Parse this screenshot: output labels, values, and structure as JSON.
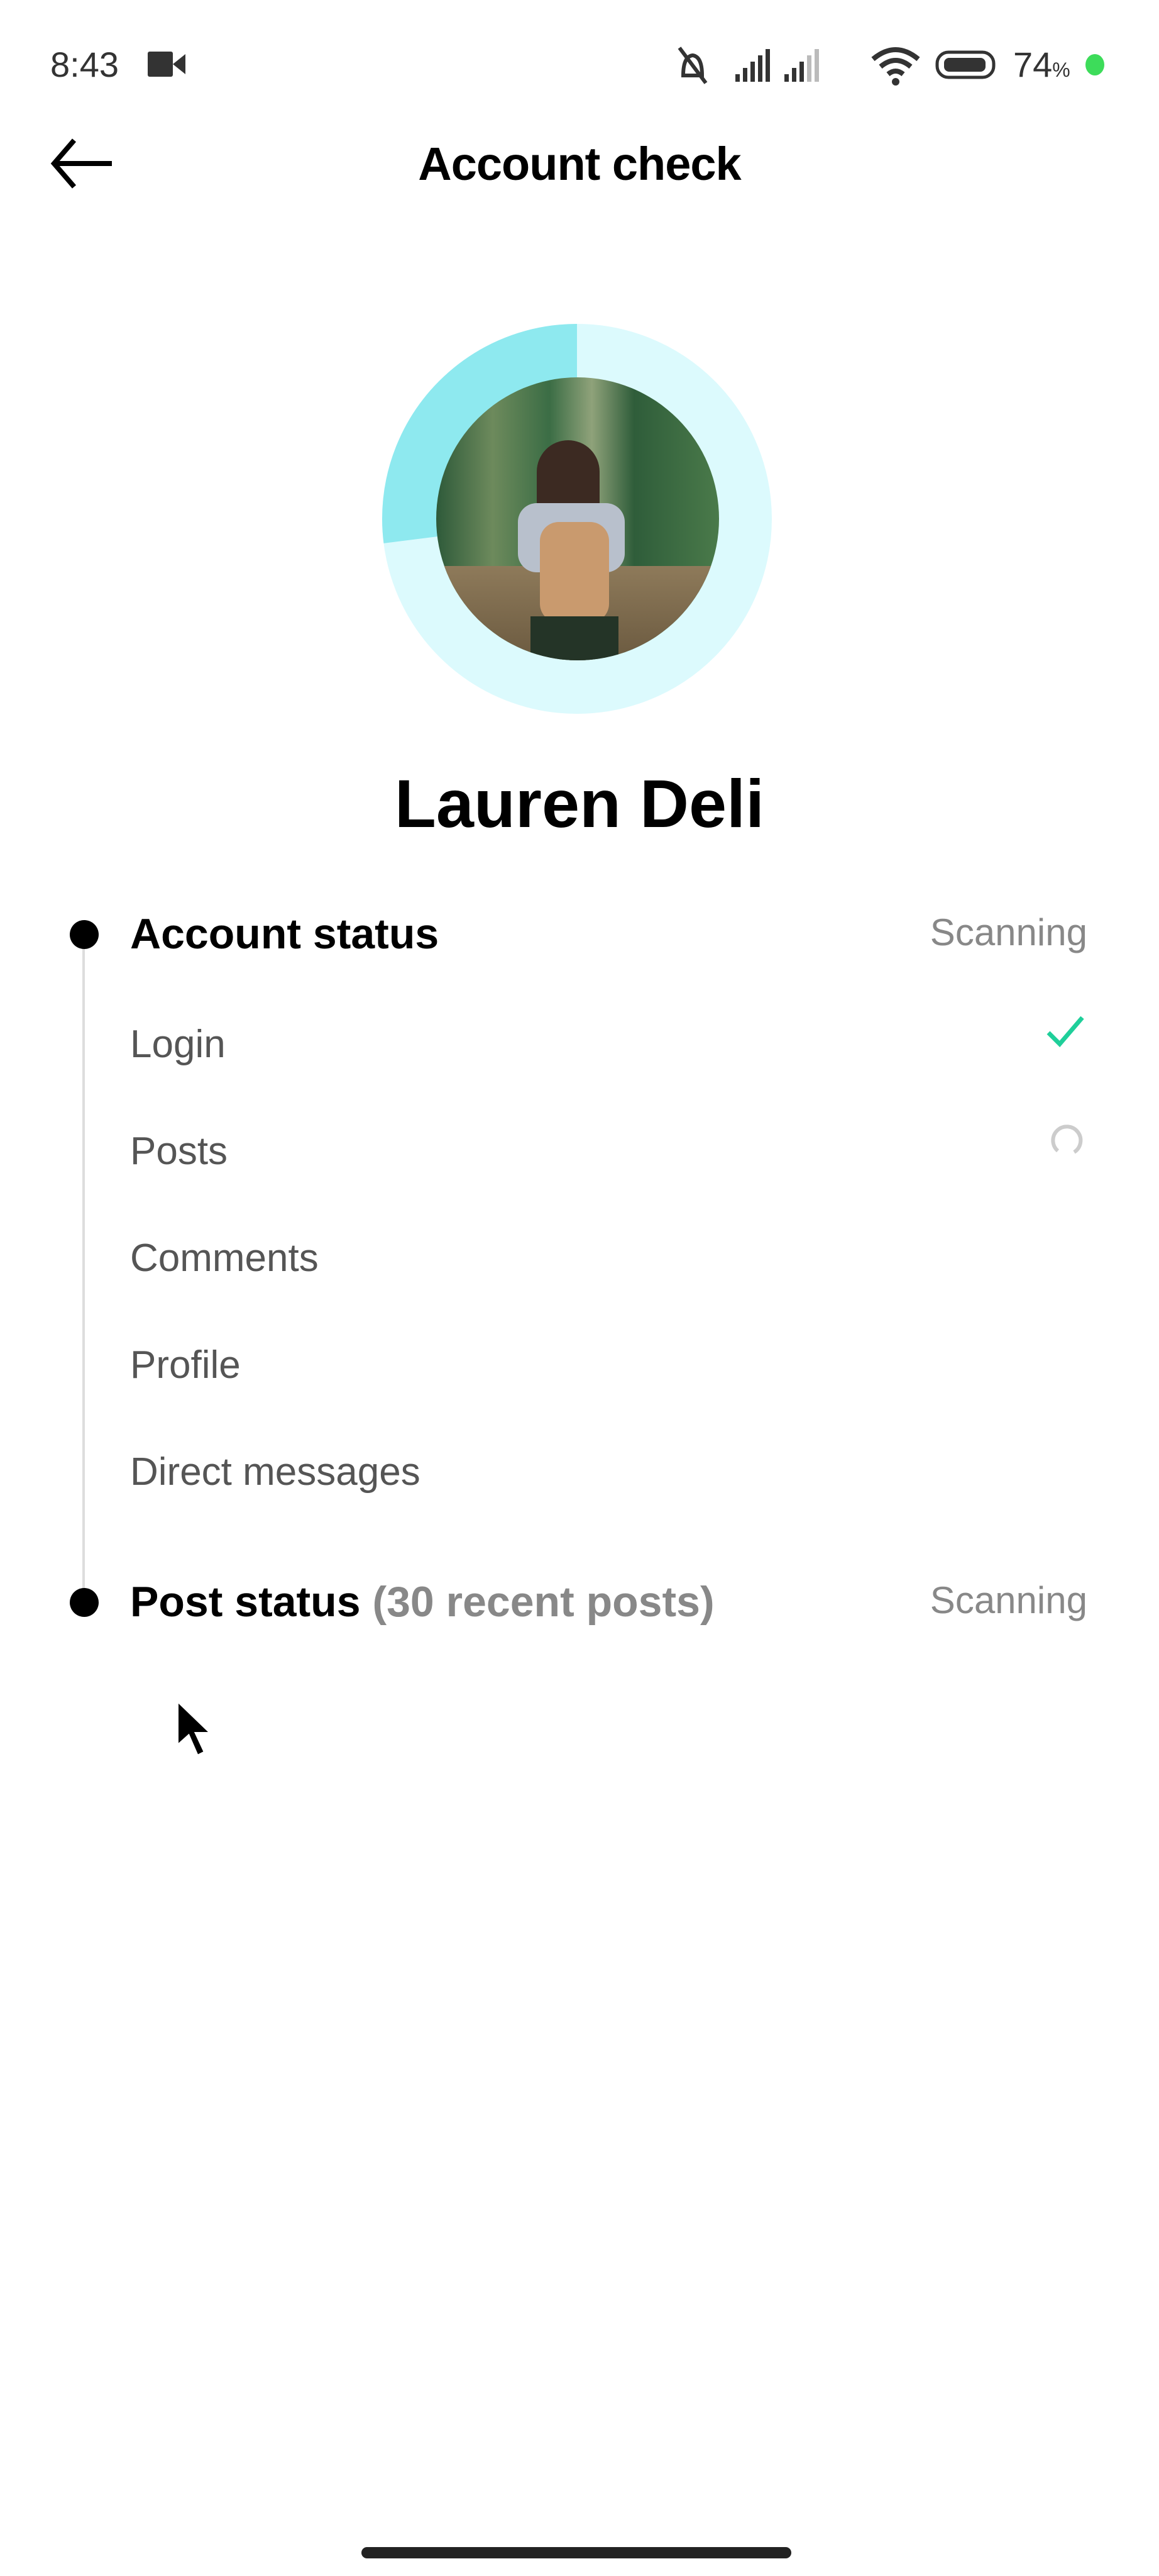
{
  "status_bar": {
    "time": "8:43",
    "battery": "74",
    "battery_unit": "%",
    "icons": [
      "video-camera-icon",
      "mute-icon",
      "signal-icon",
      "signal-icon",
      "wifi-icon",
      "battery-icon"
    ],
    "dot_color": "#3ddc5a"
  },
  "header": {
    "title": "Account check",
    "back_icon": "arrow-left-icon"
  },
  "profile": {
    "name": "Lauren Deli",
    "progress": 0.27,
    "ring_color": "#8ee9ef",
    "ring_track_color": "#dcfafd"
  },
  "sections": [
    {
      "title": "Account status",
      "suffix": "",
      "status": "Scanning",
      "items": [
        {
          "label": "Login",
          "state": "done"
        },
        {
          "label": "Posts",
          "state": "loading"
        },
        {
          "label": "Comments",
          "state": "pending"
        },
        {
          "label": "Profile",
          "state": "pending"
        },
        {
          "label": "Direct messages",
          "state": "pending"
        }
      ]
    },
    {
      "title": "Post status",
      "suffix": "(30 recent posts)",
      "status": "Scanning",
      "items": []
    }
  ],
  "colors": {
    "check": "#1fcf9a"
  }
}
